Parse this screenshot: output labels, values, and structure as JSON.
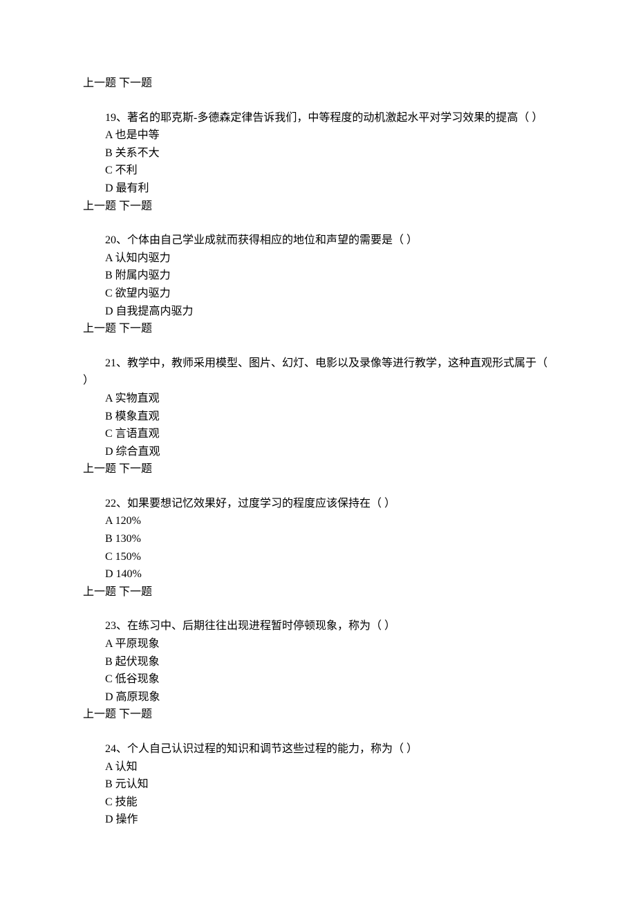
{
  "nav": {
    "prev": "上一题",
    "next": "下一题"
  },
  "questions": [
    {
      "number": "19",
      "text": "19、著名的耶克斯-多德森定律告诉我们，中等程度的动机激起水平对学习效果的提高（ ）",
      "options": [
        "A  也是中等",
        "B  关系不大",
        "C  不利",
        "D  最有利"
      ]
    },
    {
      "number": "20",
      "text": "20、个体由自己学业成就而获得相应的地位和声望的需要是（ ）",
      "options": [
        "A  认知内驱力",
        "B  附属内驱力",
        "C  欲望内驱力",
        "D  自我提高内驱力"
      ]
    },
    {
      "number": "21",
      "text": "21、教学中，教师采用模型、图片、幻灯、电影以及录像等进行教学，这种直观形式属于（ ）",
      "options": [
        "A  实物直观",
        "B  模象直观",
        "C  言语直观",
        "D  综合直观"
      ]
    },
    {
      "number": "22",
      "text": "22、如果要想记忆效果好，过度学习的程度应该保持在（ ）",
      "options": [
        "A 120%",
        "B 130%",
        "C 150%",
        "D 140%"
      ]
    },
    {
      "number": "23",
      "text": "23、在练习中、后期往往出现进程暂时停顿现象，称为（ ）",
      "options": [
        "A  平原现象",
        "B  起伏现象",
        "C  低谷现象",
        "D  高原现象"
      ]
    },
    {
      "number": "24",
      "text": "24、个人自己认识过程的知识和调节这些过程的能力，称为（ ）",
      "options": [
        "A  认知",
        "B  元认知",
        "C  技能",
        "D  操作"
      ]
    }
  ]
}
